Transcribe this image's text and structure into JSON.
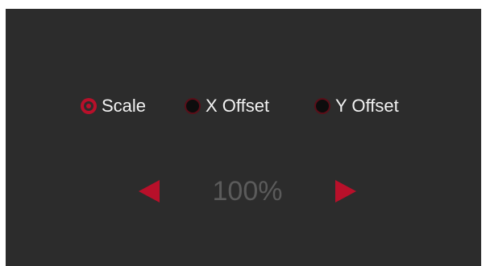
{
  "modes": [
    {
      "label": "Scale",
      "selected": true
    },
    {
      "label": "X Offset",
      "selected": false
    },
    {
      "label": "Y Offset",
      "selected": false
    }
  ],
  "value": {
    "display": "100%"
  },
  "controls": {
    "decrease_icon": "left-triangle-icon",
    "increase_icon": "right-triangle-icon"
  },
  "colors": {
    "background": "#2c2c2c",
    "accent": "#b8102a",
    "label": "#f2f2f2",
    "value": "#5b5b5b"
  }
}
